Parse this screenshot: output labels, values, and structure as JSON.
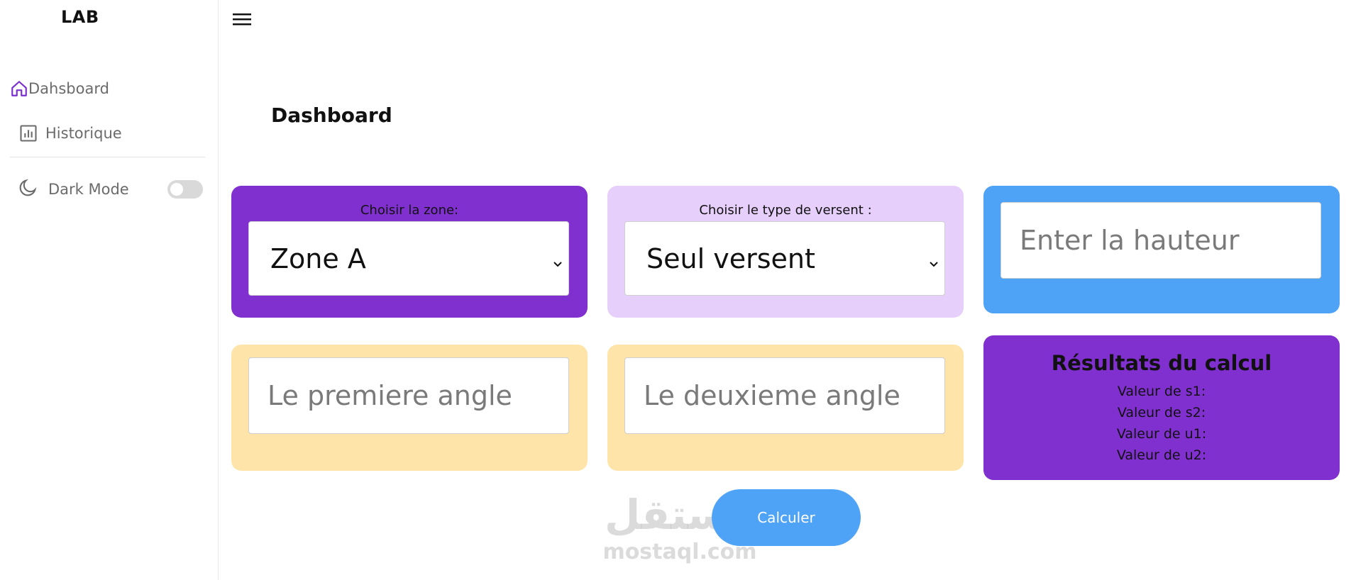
{
  "sidebar": {
    "brand": "LAB",
    "items": [
      {
        "label": "Dahsboard",
        "icon": "home-icon",
        "active": true,
        "icon_color": "#7b2fd0"
      },
      {
        "label": "Historique",
        "icon": "bar-chart-icon",
        "active": false
      }
    ],
    "dark_mode": {
      "label": "Dark Mode",
      "icon": "moon-icon",
      "enabled": false
    }
  },
  "header": {
    "menu_icon": "hamburger-menu-icon",
    "title": "Dashboard"
  },
  "cards": {
    "zone": {
      "label": "Choisir la zone:",
      "selected": "Zone A",
      "color": "#8130d0"
    },
    "type": {
      "label": "Choisir le type de versent :",
      "selected": "Seul versent",
      "color": "#e6cffb"
    },
    "hauteur": {
      "placeholder": "Enter la hauteur",
      "value": "",
      "color": "#4fa3f7"
    },
    "angle1": {
      "placeholder": "Le premiere angle",
      "value": "",
      "color": "#ffe4aa"
    },
    "angle2": {
      "placeholder": "Le deuxieme angle",
      "value": "",
      "color": "#ffe4aa"
    }
  },
  "results": {
    "title": "Résultats du calcul",
    "lines": [
      "Valeur de s1:",
      "Valeur de s2:",
      "Valeur de u1:",
      "Valeur de u2:"
    ],
    "color": "#8130d0"
  },
  "calculate_button": {
    "label": "Calculer",
    "color": "#4fa3f7"
  },
  "watermark": {
    "arabic": "مستقل",
    "latin": "mostaql.com"
  }
}
